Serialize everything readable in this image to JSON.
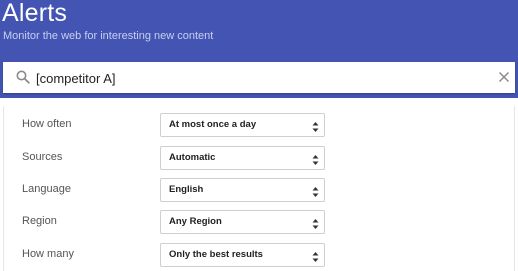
{
  "header": {
    "title": "Alerts",
    "subtitle": "Monitor the web for interesting new content",
    "bg_color": "#4354b3"
  },
  "search": {
    "value": "[competitor A]",
    "search_icon": "search-icon",
    "clear_icon": "close-icon"
  },
  "options": [
    {
      "label": "How often",
      "value": "At most once a day"
    },
    {
      "label": "Sources",
      "value": "Automatic"
    },
    {
      "label": "Language",
      "value": "English"
    },
    {
      "label": "Region",
      "value": "Any Region"
    },
    {
      "label": "How many",
      "value": "Only the best results"
    }
  ]
}
